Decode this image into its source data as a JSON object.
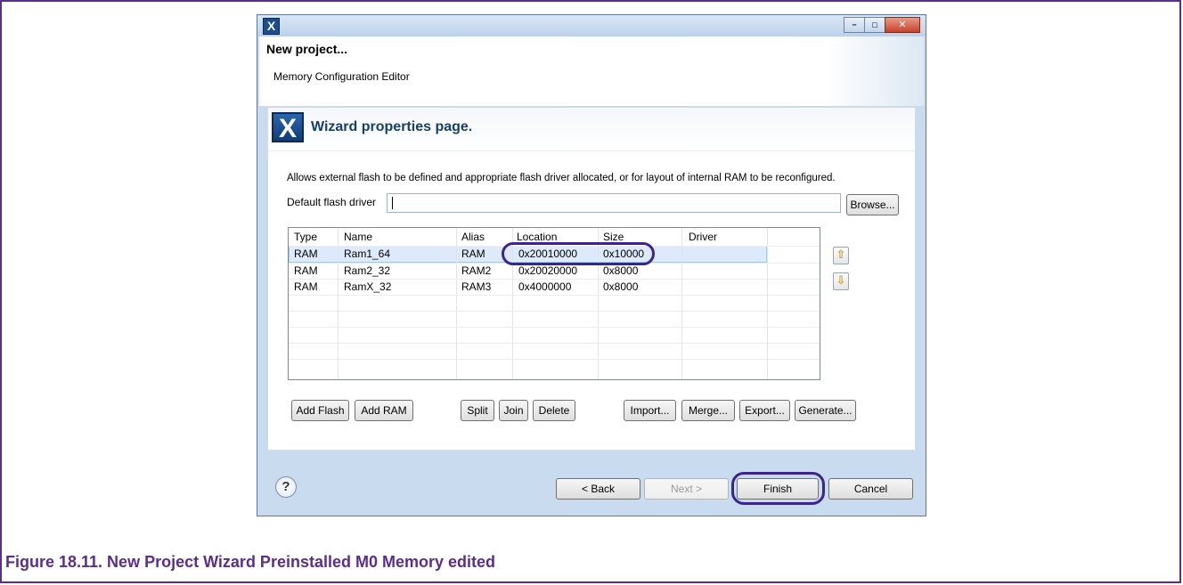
{
  "titlebar": {
    "app_icon": "X",
    "minimize": "–",
    "maximize": "▫",
    "close": "✕"
  },
  "header": {
    "title": "New project...",
    "subtitle": "Memory Configuration Editor"
  },
  "page": {
    "icon": "X",
    "title": "Wizard properties page.",
    "description": "Allows external flash to be defined and appropriate flash driver allocated, or for layout of internal RAM to be reconfigured.",
    "flash_driver_label": "Default flash driver",
    "flash_driver_value": "",
    "browse_label": "Browse..."
  },
  "table": {
    "columns": [
      "Type",
      "Name",
      "Alias",
      "Location",
      "Size",
      "Driver"
    ],
    "rows": [
      [
        "RAM",
        "Ram1_64",
        "RAM",
        "0x20010000",
        "0x10000",
        ""
      ],
      [
        "RAM",
        "Ram2_32",
        "RAM2",
        "0x20020000",
        "0x8000",
        ""
      ],
      [
        "RAM",
        "RamX_32",
        "RAM3",
        "0x4000000",
        "0x8000",
        ""
      ]
    ],
    "selected_row": 0
  },
  "move_buttons": {
    "up": "⇧",
    "down": "⇩"
  },
  "action_buttons": {
    "add_flash": "Add Flash",
    "add_ram": "Add RAM",
    "split": "Split",
    "join": "Join",
    "delete": "Delete",
    "import": "Import...",
    "merge": "Merge...",
    "export": "Export...",
    "generate": "Generate..."
  },
  "footer": {
    "help": "?",
    "back": "< Back",
    "next": "Next >",
    "finish": "Finish",
    "cancel": "Cancel"
  },
  "caption": "Figure 18.11. New Project Wizard Preinstalled M0 Memory edited",
  "colors": {
    "frame": "#5b2d8e",
    "highlight": "#3c2490",
    "title": "#15406e"
  }
}
